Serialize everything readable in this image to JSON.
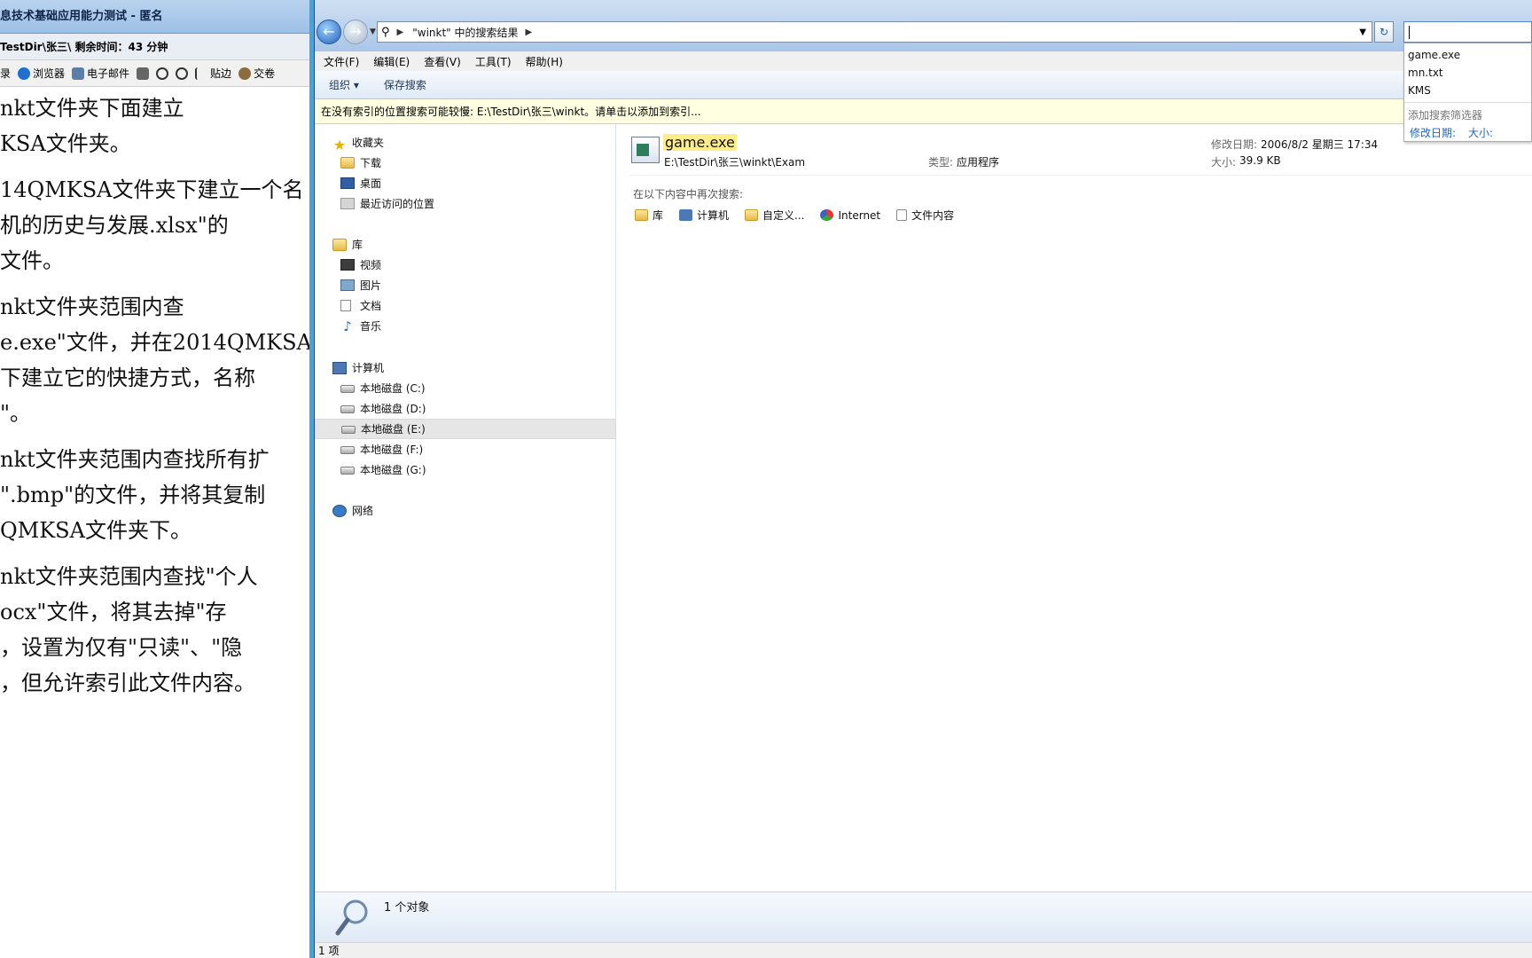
{
  "exam": {
    "title": "息技术基础应用能力测试 - 匿名",
    "info": "TestDir\\张三\\  剩余时间：43 分钟",
    "toolbar": [
      "录",
      "浏览器",
      "电子邮件",
      "",
      "",
      "",
      "贴边",
      "交卷"
    ],
    "paragraphs": [
      [
        "nkt文件夹下面建立",
        "KSA文件夹。"
      ],
      [
        "14QMKSA文件夹下建立一个名",
        "机的历史与发展.xlsx\"的",
        "文件。"
      ],
      [
        "nkt文件夹范围内查",
        "e.exe\"文件，并在2014QMKSA",
        "下建立它的快捷方式，名称",
        "\"。"
      ],
      [
        "nkt文件夹范围内查找所有扩",
        "\".bmp\"的文件，并将其复制",
        "QMKSA文件夹下。"
      ],
      [
        "nkt文件夹范围内查找\"个人",
        "ocx\"文件，将其去掉\"存",
        "，设置为仅有\"只读\"、\"隐",
        "，但允许索引此文件内容。"
      ]
    ]
  },
  "explorer": {
    "address": "\"winkt\" 中的搜索结果",
    "menu": [
      "文件(F)",
      "编辑(E)",
      "查看(V)",
      "工具(T)",
      "帮助(H)"
    ],
    "commands": [
      "组织 ▾",
      "保存搜索"
    ],
    "infobar": "在没有索引的位置搜索可能较慢: E:\\TestDir\\张三\\winkt。请单击以添加到索引...",
    "nav": {
      "favorites": "收藏夹",
      "fav_items": [
        "下载",
        "桌面",
        "最近访问的位置"
      ],
      "libraries": "库",
      "lib_items": [
        "视频",
        "图片",
        "文档",
        "音乐"
      ],
      "computer": "计算机",
      "drives": [
        "本地磁盘 (C:)",
        "本地磁盘 (D:)",
        "本地磁盘 (E:)",
        "本地磁盘 (F:)",
        "本地磁盘 (G:)"
      ],
      "network": "网络"
    },
    "result": {
      "name": "game.exe",
      "path": "E:\\TestDir\\张三\\winkt\\Exam",
      "type_label": "类型:",
      "type_value": "应用程序",
      "date_label": "修改日期:",
      "date_value": "2006/8/2 星期三 17:34",
      "size_label": "大小:",
      "size_value": "39.9 KB"
    },
    "search_again_label": "在以下内容中再次搜索:",
    "search_again": [
      "库",
      "计算机",
      "自定义...",
      "Internet",
      "文件内容"
    ],
    "details_count": "1 个对象",
    "status": "1 项"
  },
  "suggest": {
    "options": [
      "game.exe",
      "mn.txt",
      "KMS"
    ],
    "header": "添加搜索筛选器",
    "filters": [
      "修改日期:",
      "大小:"
    ]
  },
  "colors": {
    "accent": "#1e64c8",
    "highlight": "#ffed8a",
    "infobar": "#ffffe1"
  }
}
